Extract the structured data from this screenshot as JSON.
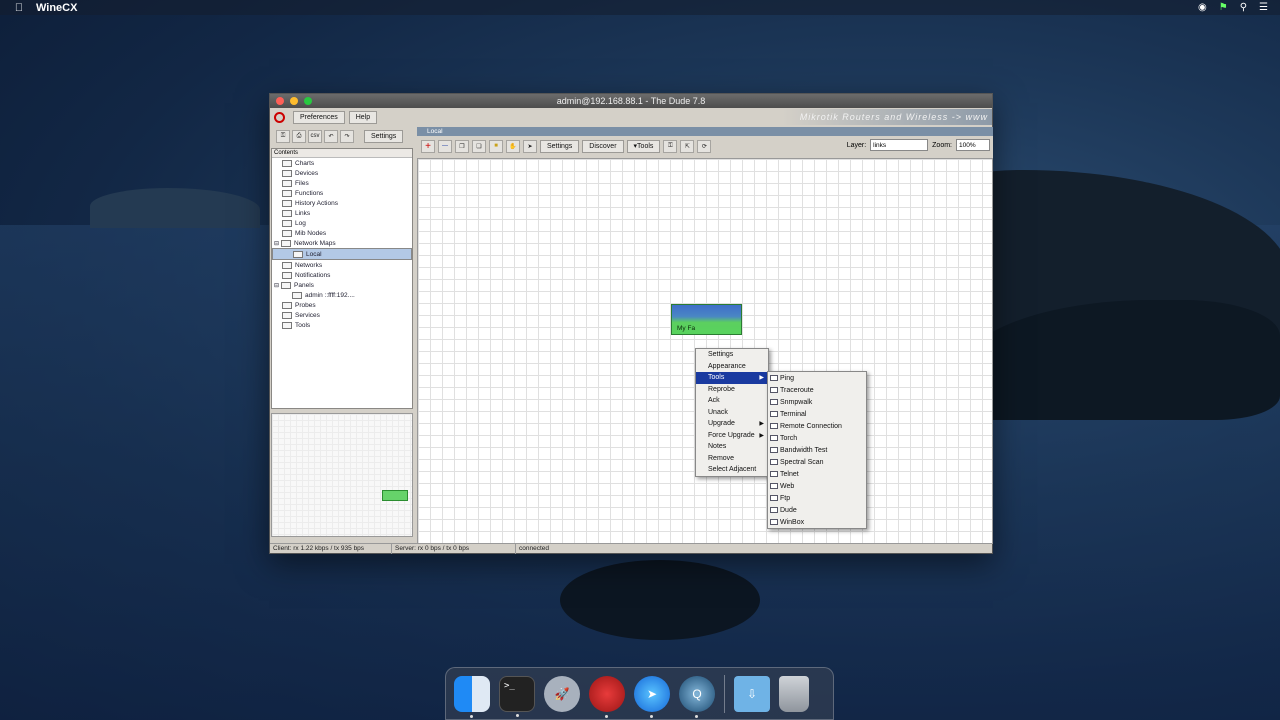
{
  "menubar": {
    "app_name": "WineCX",
    "icons": [
      "apple-icon",
      "screen-record-icon",
      "flag-icon",
      "search-icon",
      "control-center-icon"
    ]
  },
  "window": {
    "title": "admin@192.168.88.1 - The Dude 7.8",
    "menu": {
      "preferences": "Preferences",
      "help": "Help"
    },
    "banner": "Mikrotik Routers and Wireless -> www",
    "left_toolbar": {
      "settings": "Settings"
    },
    "tree": {
      "header": "Contents",
      "items": [
        {
          "label": "Charts",
          "indent": 0
        },
        {
          "label": "Devices",
          "indent": 0
        },
        {
          "label": "Files",
          "indent": 0
        },
        {
          "label": "Functions",
          "indent": 0
        },
        {
          "label": "History Actions",
          "indent": 0
        },
        {
          "label": "Links",
          "indent": 0
        },
        {
          "label": "Log",
          "indent": 0
        },
        {
          "label": "Mib Nodes",
          "indent": 0
        },
        {
          "label": "Network Maps",
          "indent": 0,
          "expanded": true
        },
        {
          "label": "Local",
          "indent": 1,
          "selected": true
        },
        {
          "label": "Networks",
          "indent": 0
        },
        {
          "label": "Notifications",
          "indent": 0
        },
        {
          "label": "Panels",
          "indent": 0,
          "expanded": true
        },
        {
          "label": "admin ::ffff:192....",
          "indent": 1
        },
        {
          "label": "Probes",
          "indent": 0
        },
        {
          "label": "Services",
          "indent": 0
        },
        {
          "label": "Tools",
          "indent": 0
        }
      ]
    },
    "map": {
      "tab": "Local",
      "toolbar": {
        "settings": "Settings",
        "discover": "Discover",
        "tools": "Tools"
      },
      "layer_label": "Layer:",
      "layer_value": "links",
      "zoom_label": "Zoom:",
      "zoom_value": "100%",
      "device_label": "My Fa"
    },
    "context_menu": {
      "items": [
        "Settings",
        "Appearance",
        "Tools",
        "Reprobe",
        "Ack",
        "Unack",
        "Upgrade",
        "Force Upgrade",
        "Notes",
        "Remove",
        "Select Adjacent"
      ],
      "highlighted": "Tools"
    },
    "tools_submenu": {
      "items": [
        "Ping",
        "Traceroute",
        "Snmpwalk",
        "Terminal",
        "Remote Connection",
        "Torch",
        "Bandwidth Test",
        "Spectral Scan",
        "Telnet",
        "Web",
        "Ftp",
        "Dude",
        "WinBox"
      ]
    },
    "status": {
      "client": "Client: rx 1.22 kbps / tx 935 bps",
      "server": "Server: rx 0 bps / tx 0 bps",
      "connection": "connected"
    }
  },
  "dock": {
    "apps": [
      "finder-icon",
      "terminal-icon",
      "launchpad-icon",
      "router-app-icon",
      "safari-icon",
      "quicktime-icon",
      "downloads-folder-icon",
      "trash-icon"
    ],
    "terminal_prompt": ">_"
  }
}
